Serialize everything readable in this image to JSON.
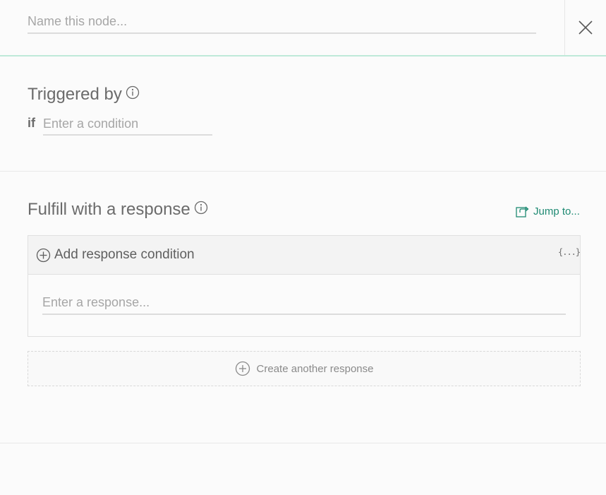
{
  "header": {
    "name_placeholder": "Name this node...",
    "close_icon": "close-icon"
  },
  "trigger": {
    "title": "Triggered by",
    "info_icon": "info-icon",
    "if_label": "if",
    "condition_placeholder": "Enter a condition"
  },
  "response": {
    "title": "Fulfill with a response",
    "info_icon": "info-icon",
    "jump_to_label": "Jump to...",
    "jump_icon": "jump-to-icon",
    "add_condition_label": "Add response condition",
    "variable_icon_text": "{...}",
    "response_placeholder": "Enter a response...",
    "create_another_label": "Create another response"
  },
  "colors": {
    "accent_teal": "#1f8a73",
    "header_border": "#bfe9d9",
    "background": "#fbfbfb"
  }
}
